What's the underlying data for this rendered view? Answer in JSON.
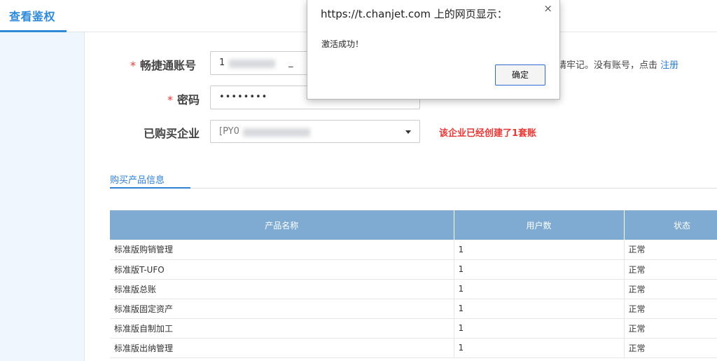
{
  "header": {
    "active_tab": "查看鉴权"
  },
  "form": {
    "account": {
      "label": "畅捷通账号",
      "required_mark": "*",
      "value": "1                      _"
    },
    "password": {
      "label": "密码",
      "required_mark": "*",
      "value": "••••••••"
    },
    "company": {
      "label": "已购买企业",
      "value": "[PY0"
    },
    "account_hint": "请牢记。没有账号，点击",
    "register_link": "注册",
    "company_warning": "该企业已经创建了1套账"
  },
  "subtab": {
    "label": "购买产品信息"
  },
  "table": {
    "columns": [
      "产品名称",
      "用户数",
      "状态"
    ],
    "rows": [
      {
        "name": "标准版购销管理",
        "users": "1",
        "status": "正常"
      },
      {
        "name": "标准版T-UFO",
        "users": "1",
        "status": "正常"
      },
      {
        "name": "标准版总账",
        "users": "1",
        "status": "正常"
      },
      {
        "name": "标准版固定资产",
        "users": "1",
        "status": "正常"
      },
      {
        "name": "标准版自制加工",
        "users": "1",
        "status": "正常"
      },
      {
        "name": "标准版出纳管理",
        "users": "1",
        "status": "正常"
      }
    ]
  },
  "dialog": {
    "title": "https://t.chanjet.com 上的网页显示：",
    "close": "×",
    "message": "激活成功！",
    "ok_label": "确定"
  }
}
